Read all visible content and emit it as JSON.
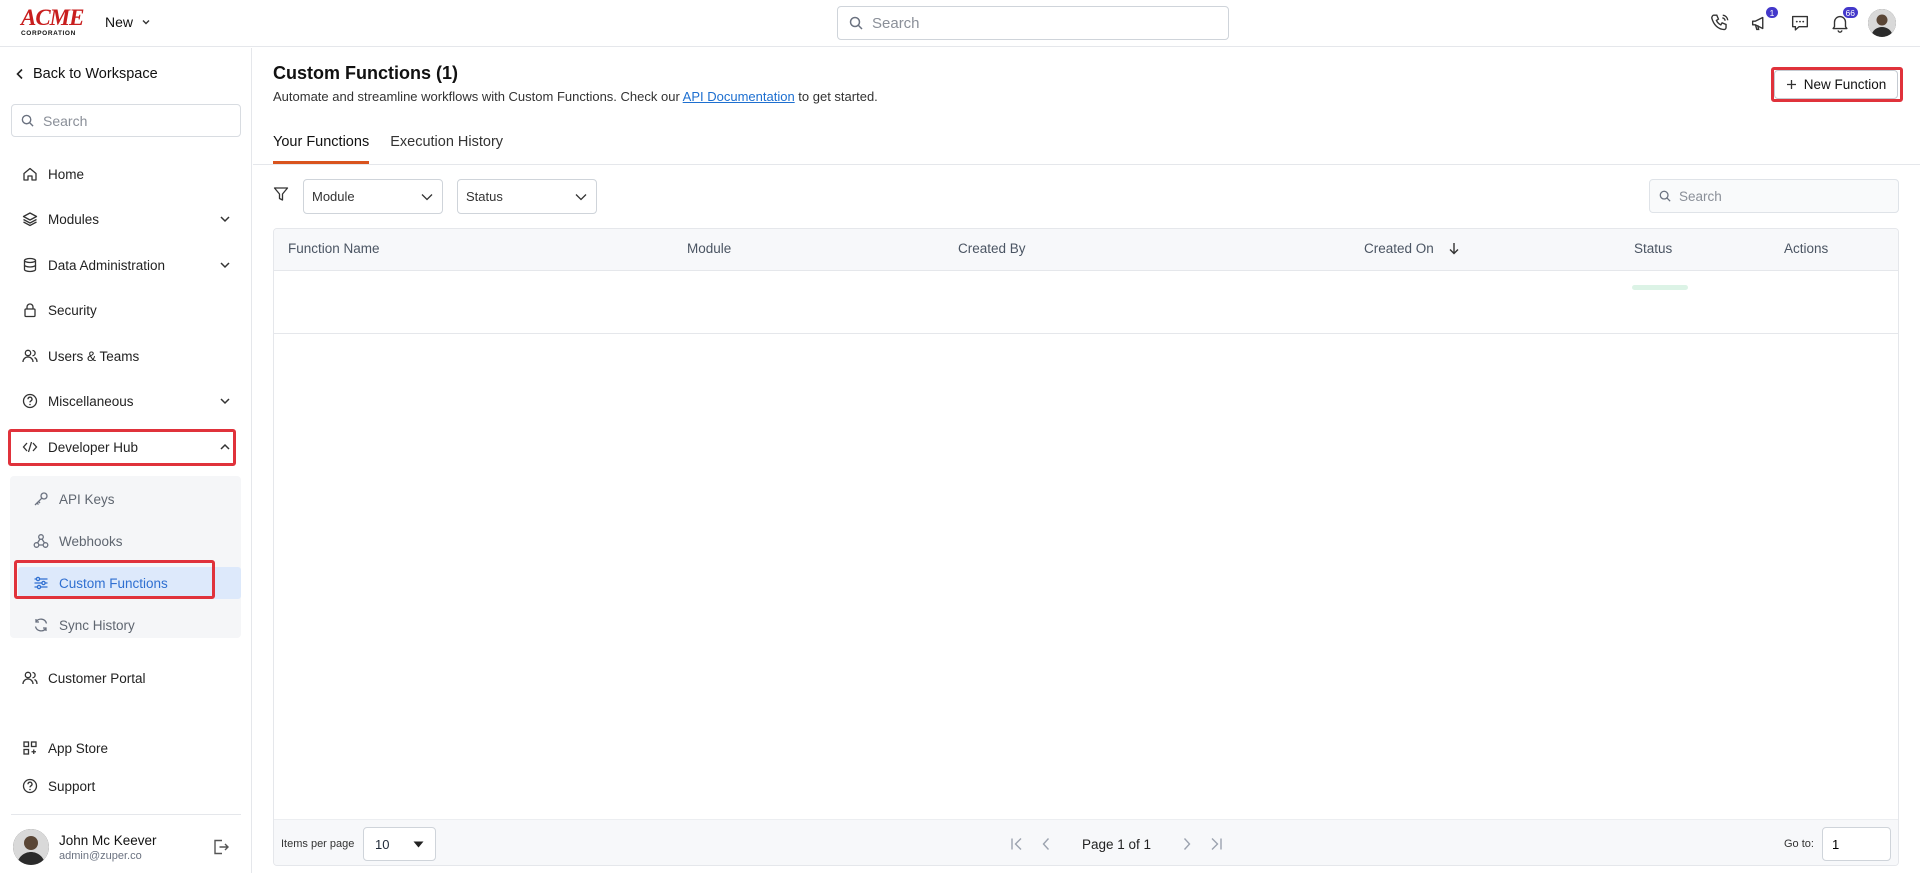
{
  "header": {
    "logo_line1": "ACME",
    "logo_line2": "CORPORATION",
    "new_label": "New",
    "search_placeholder": "Search",
    "announcements_badge": "1",
    "notifications_badge": "66"
  },
  "sidebar": {
    "back_label": "Back to Workspace",
    "search_placeholder": "Search",
    "items": {
      "home": "Home",
      "modules": "Modules",
      "data_admin": "Data Administration",
      "security": "Security",
      "users_teams": "Users & Teams",
      "misc": "Miscellaneous",
      "dev_hub": "Developer Hub",
      "customer_portal": "Customer Portal",
      "app_store": "App Store",
      "support": "Support"
    },
    "dev_hub_children": {
      "api_keys": "API Keys",
      "webhooks": "Webhooks",
      "custom_functions": "Custom Functions",
      "sync_history": "Sync History"
    },
    "user": {
      "name": "John Mc Keever",
      "email": "admin@zuper.co"
    }
  },
  "main": {
    "title": "Custom Functions (1)",
    "description_prefix": "Automate and streamline workflows with Custom Functions. Check our ",
    "description_link": "API Documentation",
    "description_suffix": " to get started.",
    "new_function_label": "New Function",
    "tabs": {
      "your_functions": "Your Functions",
      "execution_history": "Execution History"
    },
    "filters": {
      "module": "Module",
      "status": "Status",
      "search_placeholder": "Search"
    },
    "table": {
      "columns": {
        "function_name": "Function Name",
        "module": "Module",
        "created_by": "Created By",
        "created_on": "Created On",
        "status": "Status",
        "actions": "Actions"
      }
    },
    "pagination": {
      "items_per_page_label": "Items per page",
      "items_per_page": "10",
      "page_text": "Page 1 of 1",
      "goto_label": "Go to:",
      "goto_value": "1"
    }
  },
  "colors": {
    "accent": "#d9541e",
    "highlight": "#e0323b",
    "link": "#1d6fd0",
    "active_bg": "#dde9fb",
    "badge": "#4338ca"
  }
}
